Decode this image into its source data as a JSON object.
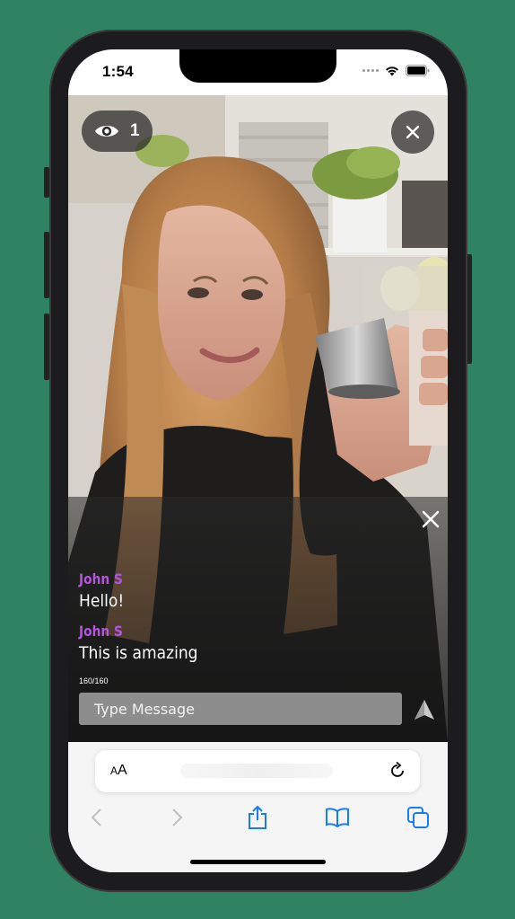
{
  "status_bar": {
    "time": "1:54"
  },
  "stream": {
    "viewer_count": "1"
  },
  "chat": {
    "messages": [
      {
        "user": "John S",
        "text": "Hello!"
      },
      {
        "user": "John S",
        "text": "This is amazing"
      }
    ],
    "char_count": "160/160",
    "input": {
      "value": "",
      "placeholder": "Type Message"
    }
  },
  "browser": {
    "text_size_label_small": "A",
    "text_size_label_large": "A"
  },
  "colors": {
    "background": "#2f8363",
    "username": "#b653e0",
    "safari_accent": "#1a7cf5"
  },
  "icons": {
    "viewers": "eye-icon",
    "close": "close-icon",
    "send": "send-icon",
    "reload": "reload-icon",
    "back": "chevron-left-icon",
    "forward": "chevron-right-icon",
    "share": "share-icon",
    "bookmarks": "book-icon",
    "tabs": "tabs-icon"
  }
}
